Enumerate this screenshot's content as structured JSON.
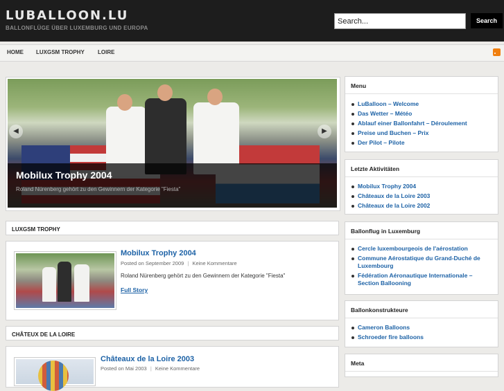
{
  "site": {
    "title": "LUBALLOON.LU",
    "tagline": "BALLONFLÜGE ÜBER LUXEMBURG UND EUROPA"
  },
  "search": {
    "placeholder": "Search...",
    "value": "Search...",
    "button": "Search"
  },
  "nav": {
    "items": [
      "HOME",
      "LUXGSM TROPHY",
      "LOIRE"
    ]
  },
  "slider": {
    "title": "Mobilux Trophy 2004",
    "text": "Roland Nürenberg gehört zu den Gewinnern der Kategorie \"Fiesta\""
  },
  "sections": [
    {
      "title": "LUXGSM TROPHY",
      "post": {
        "title": "Mobilux Trophy 2004",
        "meta_date": "Posted on September 2009",
        "meta_comments": "Keine Kommentare",
        "excerpt": "Roland Nürenberg gehört zu den Gewinnern der Kategorie \"Fiesta\"",
        "more": "Full Story"
      }
    },
    {
      "title": "CHÂTEUX DE LA LOIRE",
      "post": {
        "title": "Châteaux de la Loire 2003",
        "meta_date": "Posted on Mai 2003",
        "meta_comments": "Keine Kommentare"
      }
    }
  ],
  "meta_separator": "|",
  "sidebar": {
    "widgets": [
      {
        "title": "Menu",
        "items": [
          "LuBalloon – Welcome",
          "Das Wetter – Météo",
          "Ablauf einer Ballonfahrt – Déroulement",
          "Preise und Buchen – Prix",
          "Der Pilot – Pilote"
        ]
      },
      {
        "title": "Letzte Aktivitäten",
        "items": [
          "Mobilux Trophy 2004",
          "Châteaux de la Loire 2003",
          "Châteaux de la Loire 2002"
        ]
      },
      {
        "title": "Ballonflug in Luxemburg",
        "items": [
          "Cercle luxembourgeois de l'aérostation",
          "Commune Aérostatique du Grand-Duché de Luxembourg",
          "Fédération Aéronautique Internationale – Section Ballooning"
        ]
      },
      {
        "title": "Ballonkonstrukteure",
        "items": [
          "Cameron Balloons",
          "Schroeder fire balloons"
        ]
      },
      {
        "title": "Meta",
        "items": []
      }
    ]
  },
  "colors": {
    "link": "#1d62a6",
    "header_bg": "#1d1d1d",
    "rss": "#f07f0f"
  }
}
